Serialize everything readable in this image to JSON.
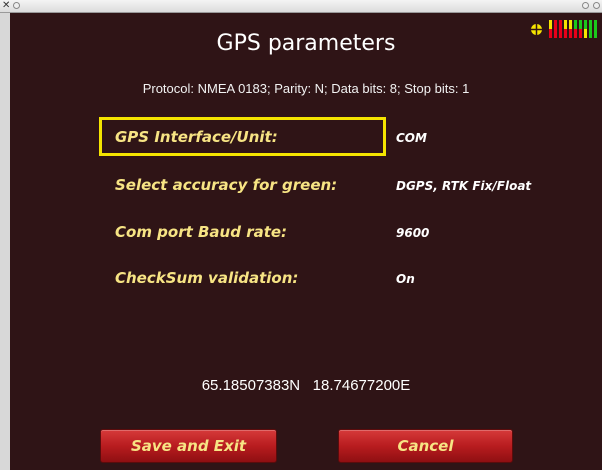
{
  "window": {
    "close_glyph": "✕"
  },
  "header": {
    "title": "GPS parameters",
    "protocol_line": "Protocol: NMEA 0183; Parity: N; Data bits: 8; Stop bits: 1"
  },
  "gps_indicator": {
    "icon": "crosshair-icon",
    "bar_colors": [
      "#e8001a",
      "#1cc81c",
      "#f7e500"
    ]
  },
  "settings": [
    {
      "label": "GPS Interface/Unit:",
      "value": "COM",
      "selected": true
    },
    {
      "label": "Select accuracy for green:",
      "value": "DGPS, RTK Fix/Float",
      "selected": false
    },
    {
      "label": "Com port Baud rate:",
      "value": "9600",
      "selected": false
    },
    {
      "label": "CheckSum validation:",
      "value": "On",
      "selected": false
    }
  ],
  "position": {
    "latitude": "65.18507383N",
    "longitude": "18.74677200E"
  },
  "buttons": {
    "save_label": "Save and Exit",
    "cancel_label": "Cancel"
  },
  "colors": {
    "background": "#2f1416",
    "label": "#f7e484",
    "highlight": "#f4e400",
    "button": "#b81c1f"
  }
}
